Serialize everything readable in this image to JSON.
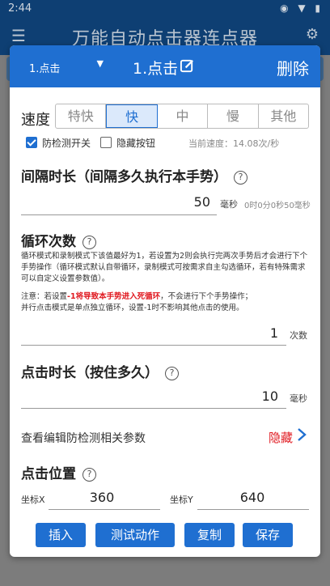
{
  "status": {
    "time": "2:44",
    "icons": "◉ ▼ ▮"
  },
  "appbar": {
    "title": "万能自动点击器连点器",
    "menu_icon": "menu-icon",
    "robot_icon": "robot-icon"
  },
  "dialog": {
    "dropdown_label": "1.点击",
    "title": "1.点击",
    "delete_label": "删除",
    "speed": {
      "label": "速度",
      "options": [
        "特快",
        "快",
        "中",
        "慢",
        "其他"
      ],
      "selected": "快"
    },
    "anti_detect_label": "防检测开关",
    "anti_detect_checked": true,
    "hide_button_label": "隐藏按钮",
    "hide_button_checked": false,
    "current_speed": "当前速度：14.08次/秒",
    "interval": {
      "title": "间隔时长（间隔多久执行本手势）",
      "value": "50",
      "unit": "毫秒",
      "hint": "0时0分0秒50毫秒"
    },
    "loop": {
      "title": "循环次数",
      "desc1": "循环模式和录制模式下该值最好为1，若设置为2则会执行完两次手势后才会进行下个手势操作（循环模式默认自带循环，录制模式可按需求自主勾选循环，若有特殊需求可以自定义设置参数值）。",
      "note_prefix": "注意：若设置",
      "note_red": "-1将导致本手势进入死循环",
      "note_suffix": "，不会进行下个手势操作；",
      "note2": "并行点击模式是单点独立循环，设置-1时不影响其他点击的使用。",
      "value": "1",
      "unit": "次数"
    },
    "press": {
      "title": "点击时长（按住多久）",
      "value": "10",
      "unit": "毫秒"
    },
    "anti_params_link": "查看编辑防检测相关参数",
    "hide_link": "隐藏",
    "position": {
      "title": "点击位置",
      "x_label": "坐标X",
      "x_value": "360",
      "y_label": "坐标Y",
      "y_value": "640"
    },
    "buttons": {
      "insert": "插入",
      "test": "测试动作",
      "copy": "复制",
      "save": "保存"
    }
  },
  "colors": {
    "primary": "#1f6fd1",
    "danger": "#e0181f",
    "appbar": "#0e3f73"
  }
}
